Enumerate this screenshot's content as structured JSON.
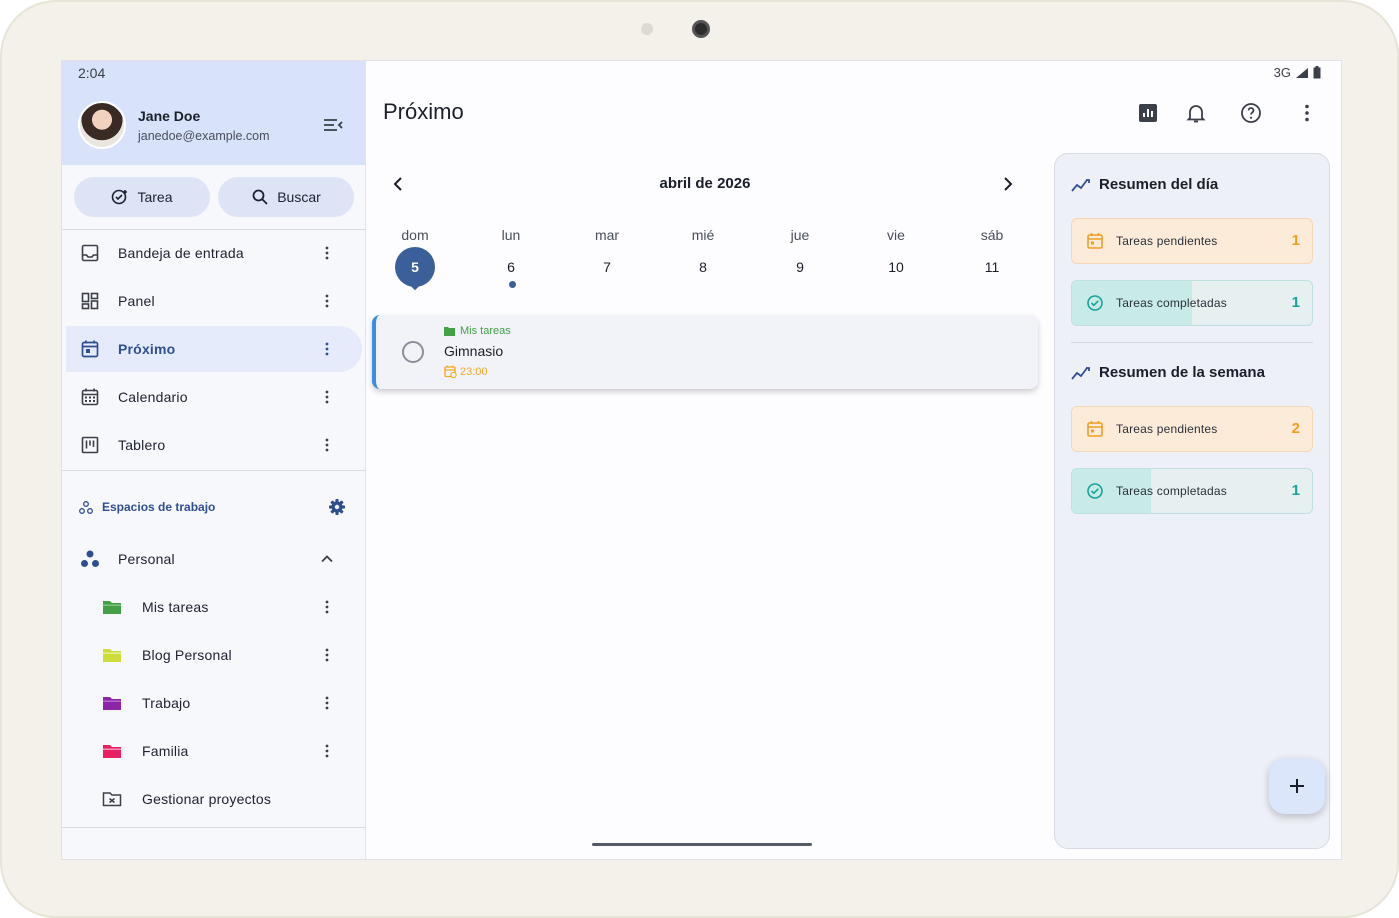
{
  "status": {
    "time": "2:04",
    "network": "3G"
  },
  "user": {
    "name": "Jane Doe",
    "email": "janedoe@example.com"
  },
  "actions": {
    "task_label": "Tarea",
    "search_label": "Buscar"
  },
  "nav": {
    "items": [
      {
        "label": "Bandeja de entrada",
        "icon": "inbox-icon"
      },
      {
        "label": "Panel",
        "icon": "dashboard-icon"
      },
      {
        "label": "Próximo",
        "icon": "upcoming-calendar-icon",
        "active": true
      },
      {
        "label": "Calendario",
        "icon": "calendar-grid-icon"
      },
      {
        "label": "Tablero",
        "icon": "board-icon"
      }
    ]
  },
  "workspaces": {
    "title": "Espacios de trabajo",
    "group": "Personal",
    "projects": [
      {
        "label": "Mis tareas",
        "color": "#43a047"
      },
      {
        "label": "Blog Personal",
        "color": "#cddc39"
      },
      {
        "label": "Trabajo",
        "color": "#8e24aa"
      },
      {
        "label": "Familia",
        "color": "#e91e63"
      }
    ],
    "manage_label": "Gestionar proyectos"
  },
  "page": {
    "title": "Próximo"
  },
  "calendar": {
    "month_label": "abril de 2026",
    "weekdays": [
      "dom",
      "lun",
      "mar",
      "mié",
      "jue",
      "vie",
      "sáb"
    ],
    "days": [
      "5",
      "6",
      "7",
      "8",
      "9",
      "10",
      "11"
    ],
    "today_index": 0
  },
  "task": {
    "list": "Mis tareas",
    "title": "Gimnasio",
    "time": "23:00"
  },
  "summary": {
    "day": {
      "title": "Resumen del día",
      "pending_label": "Tareas pendientes",
      "pending_count": "1",
      "done_label": "Tareas completadas",
      "done_count": "1",
      "done_progress_pct": 50
    },
    "week": {
      "title": "Resumen de la semana",
      "pending_label": "Tareas pendientes",
      "pending_count": "2",
      "done_label": "Tareas completadas",
      "done_count": "1",
      "done_progress_pct": 33
    }
  },
  "colors": {
    "accent": "#3b5f98",
    "header": "#d8e2fb",
    "task_border": "#3a8de0",
    "pending": "#f0a020",
    "done": "#16a39a"
  }
}
